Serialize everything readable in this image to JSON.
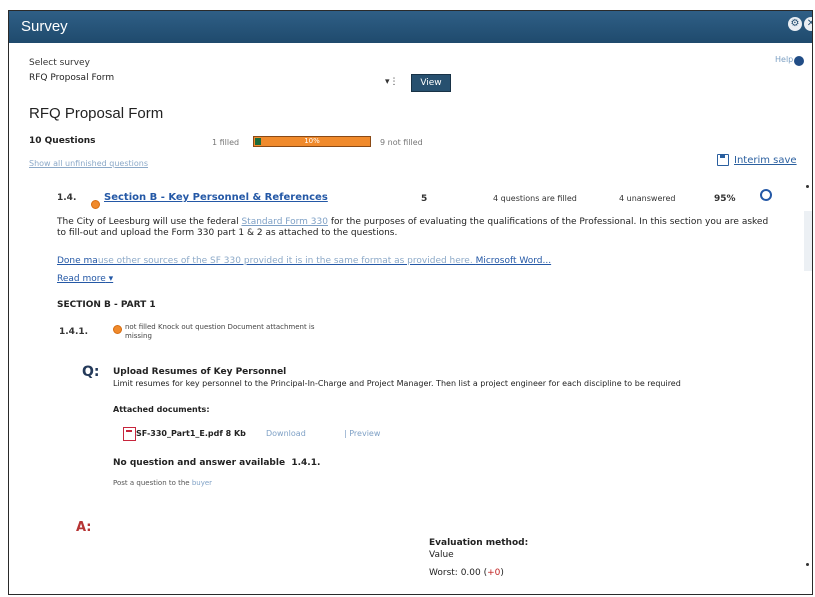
{
  "window": {
    "title": "Survey"
  },
  "survey_selector": {
    "label": "Select survey",
    "selected": "RFQ Proposal Form",
    "view_label": "View"
  },
  "help_label": "Help",
  "form": {
    "title": "RFQ Proposal Form",
    "question_count": "10 Questions",
    "filled_text": "1 filled",
    "progress_percent": 10,
    "progress_label": "10%",
    "not_filled_text": "9 not filled",
    "show_all_link": "Show all unfinished questions",
    "interim_save": "Interim save"
  },
  "section": {
    "number": "1.4.",
    "title": "Section B - Key Personnel & References",
    "count": "5",
    "questions_filled": "4 questions are filled",
    "unanswered": "4 unanswered",
    "percent": "95%",
    "description_pre": "The City of Leesburg will use the federal ",
    "description_link": "Standard Form 330",
    "description_post": " for the purposes of evaluating the qualifications of the Professional. In this section you are asked to fill-out and upload the Form 330 part 1 & 2 as attached to the questions.",
    "doc_line_start": "Done ma",
    "doc_line_faint": "use other sources of the SF 330 provided it is in the same format as provided here. ",
    "doc_line_end": "Microsoft Word...",
    "read_more": "Read more",
    "part_heading": "SECTION B - PART 1"
  },
  "question": {
    "number": "1.4.1.",
    "status_text": "not filled Knock out question Document attachment is missing",
    "q_marker": "Q:",
    "title": "Upload Resumes of Key Personnel",
    "text": "Limit resumes for key personnel to the Principal-In-Charge and Project Manager. Then list a project engineer for each discipline to be required",
    "attached_label": "Attached documents:",
    "file_name": "SF-330_Part1_E.pdf 8 Kb",
    "download_label": "Download",
    "preview_label": "Preview",
    "no_qa": "No question and answer available",
    "no_qa_number": "1.4.1.",
    "post_question_pre": "Post a question to the ",
    "post_question_link": "buyer"
  },
  "answer": {
    "a_marker": "A:",
    "evaluation_method_label": "Evaluation method:",
    "evaluation_value": "Value",
    "worst_label": "Worst: 0.00 (",
    "worst_value": "+0",
    "worst_suffix": ")"
  }
}
